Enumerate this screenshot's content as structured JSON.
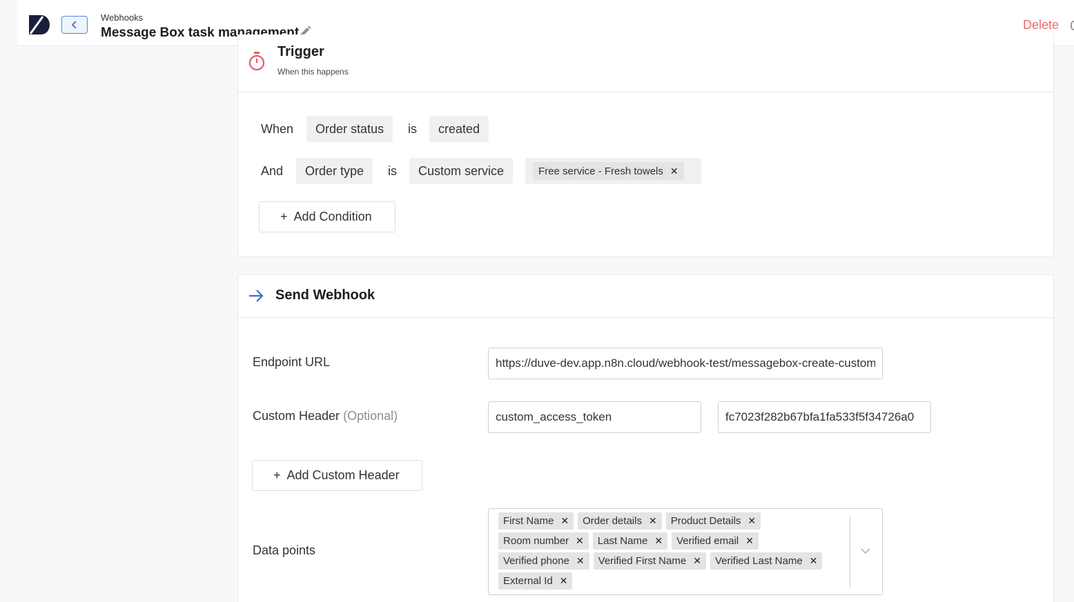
{
  "header": {
    "breadcrumb": "Webhooks",
    "title": "Message Box task management",
    "delete_label": "Delete"
  },
  "trigger": {
    "title": "Trigger",
    "subtitle": "When this happens",
    "conditions": [
      {
        "connector": "When",
        "field": "Order status",
        "operator": "is",
        "value": "created"
      },
      {
        "connector": "And",
        "field": "Order type",
        "operator": "is",
        "value": "Custom service",
        "tags": [
          "Free service - Fresh towels"
        ]
      }
    ],
    "add_condition_label": "Add Condition"
  },
  "webhook": {
    "title": "Send Webhook",
    "endpoint_label": "Endpoint URL",
    "endpoint_value": "https://duve-dev.app.n8n.cloud/webhook-test/messagebox-create-custom",
    "custom_header_label": "Custom Header",
    "custom_header_optional": "(Optional)",
    "custom_header_key": "custom_access_token",
    "custom_header_value": "fc7023f282b67bfa1fa533f5f34726a0",
    "add_custom_header_label": "Add Custom Header",
    "data_points_label": "Data points",
    "data_points": [
      "First Name",
      "Order details",
      "Product Details",
      "Room number",
      "Last Name",
      "Verified email",
      "Verified phone",
      "Verified First Name",
      "Verified Last Name",
      "External Id"
    ]
  },
  "icons": {
    "logo": "duve-logo-icon",
    "back": "chevron-left-icon",
    "edit": "pencil-icon",
    "trigger": "stopwatch-icon",
    "webhook": "arrow-right-icon",
    "remove": "close-icon",
    "dropdown": "chevron-down-icon"
  },
  "colors": {
    "accent": "#3c6fc4",
    "delete": "#e8696e",
    "trigger_icon": "#e05c6a"
  }
}
